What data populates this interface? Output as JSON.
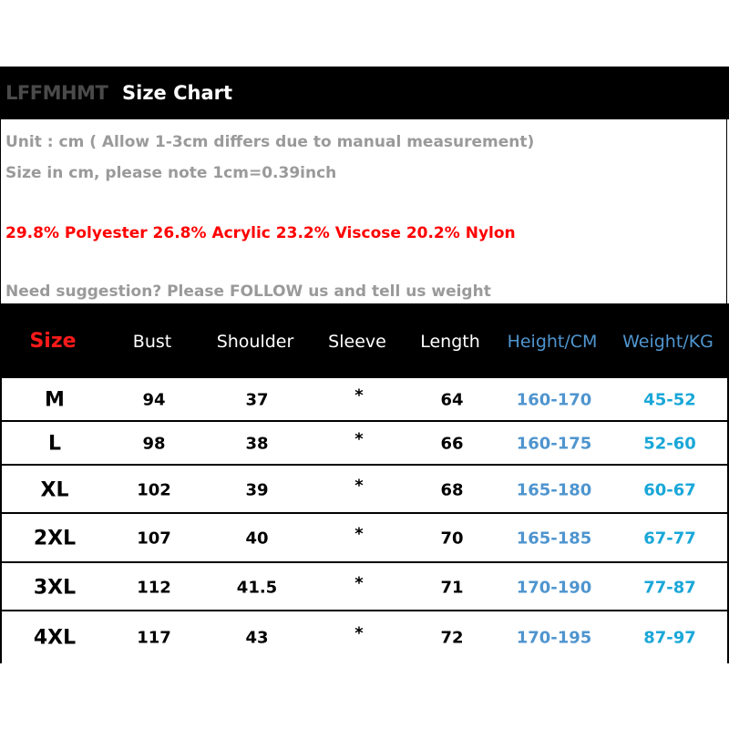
{
  "title": {
    "brand": "LFFMHMT",
    "text": "Size Chart"
  },
  "info": {
    "unit": "Unit : cm ( Allow 1-3cm differs due to manual measurement)",
    "conversion": "Size in cm, please note 1cm=0.39inch",
    "material": "29.8% Polyester 26.8% Acrylic 23.2% Viscose 20.2% Nylon",
    "suggestion": "Need suggestion? Please FOLLOW us and tell us weight"
  },
  "colors": {
    "header_bg": "#000000",
    "size_label": "#ff1a1a",
    "height_blue": "#4f95cf",
    "weight_blue": "#1aa7d8",
    "material_red": "#ff0000",
    "info_grey": "#9a9a9a"
  },
  "table": {
    "headers": [
      "Size",
      "Bust",
      "Shoulder",
      "Sleeve",
      "Length",
      "Height/CM",
      "Weight/KG"
    ],
    "rows": [
      [
        "M",
        "94",
        "37",
        "*",
        "64",
        "160-170",
        "45-52"
      ],
      [
        "L",
        "98",
        "38",
        "*",
        "66",
        "160-175",
        "52-60"
      ],
      [
        "XL",
        "102",
        "39",
        "*",
        "68",
        "165-180",
        "60-67"
      ],
      [
        "2XL",
        "107",
        "40",
        "*",
        "70",
        "165-185",
        "67-77"
      ],
      [
        "3XL",
        "112",
        "41.5",
        "*",
        "71",
        "170-190",
        "77-87"
      ],
      [
        "4XL",
        "117",
        "43",
        "*",
        "72",
        "170-195",
        "87-97"
      ]
    ]
  }
}
